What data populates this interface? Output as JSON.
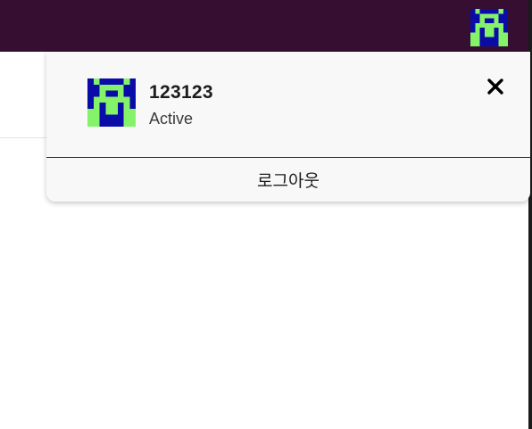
{
  "header": {
    "avatar_icon": "pixel-alien-avatar",
    "background_color": "#350e32"
  },
  "profile_popup": {
    "username": "123123",
    "status": "Active",
    "logout_label": "로그아웃",
    "close_icon": "close-x-icon",
    "avatar_colors": {
      "background": "#0b0ba8",
      "figure": "#84f36a"
    }
  }
}
